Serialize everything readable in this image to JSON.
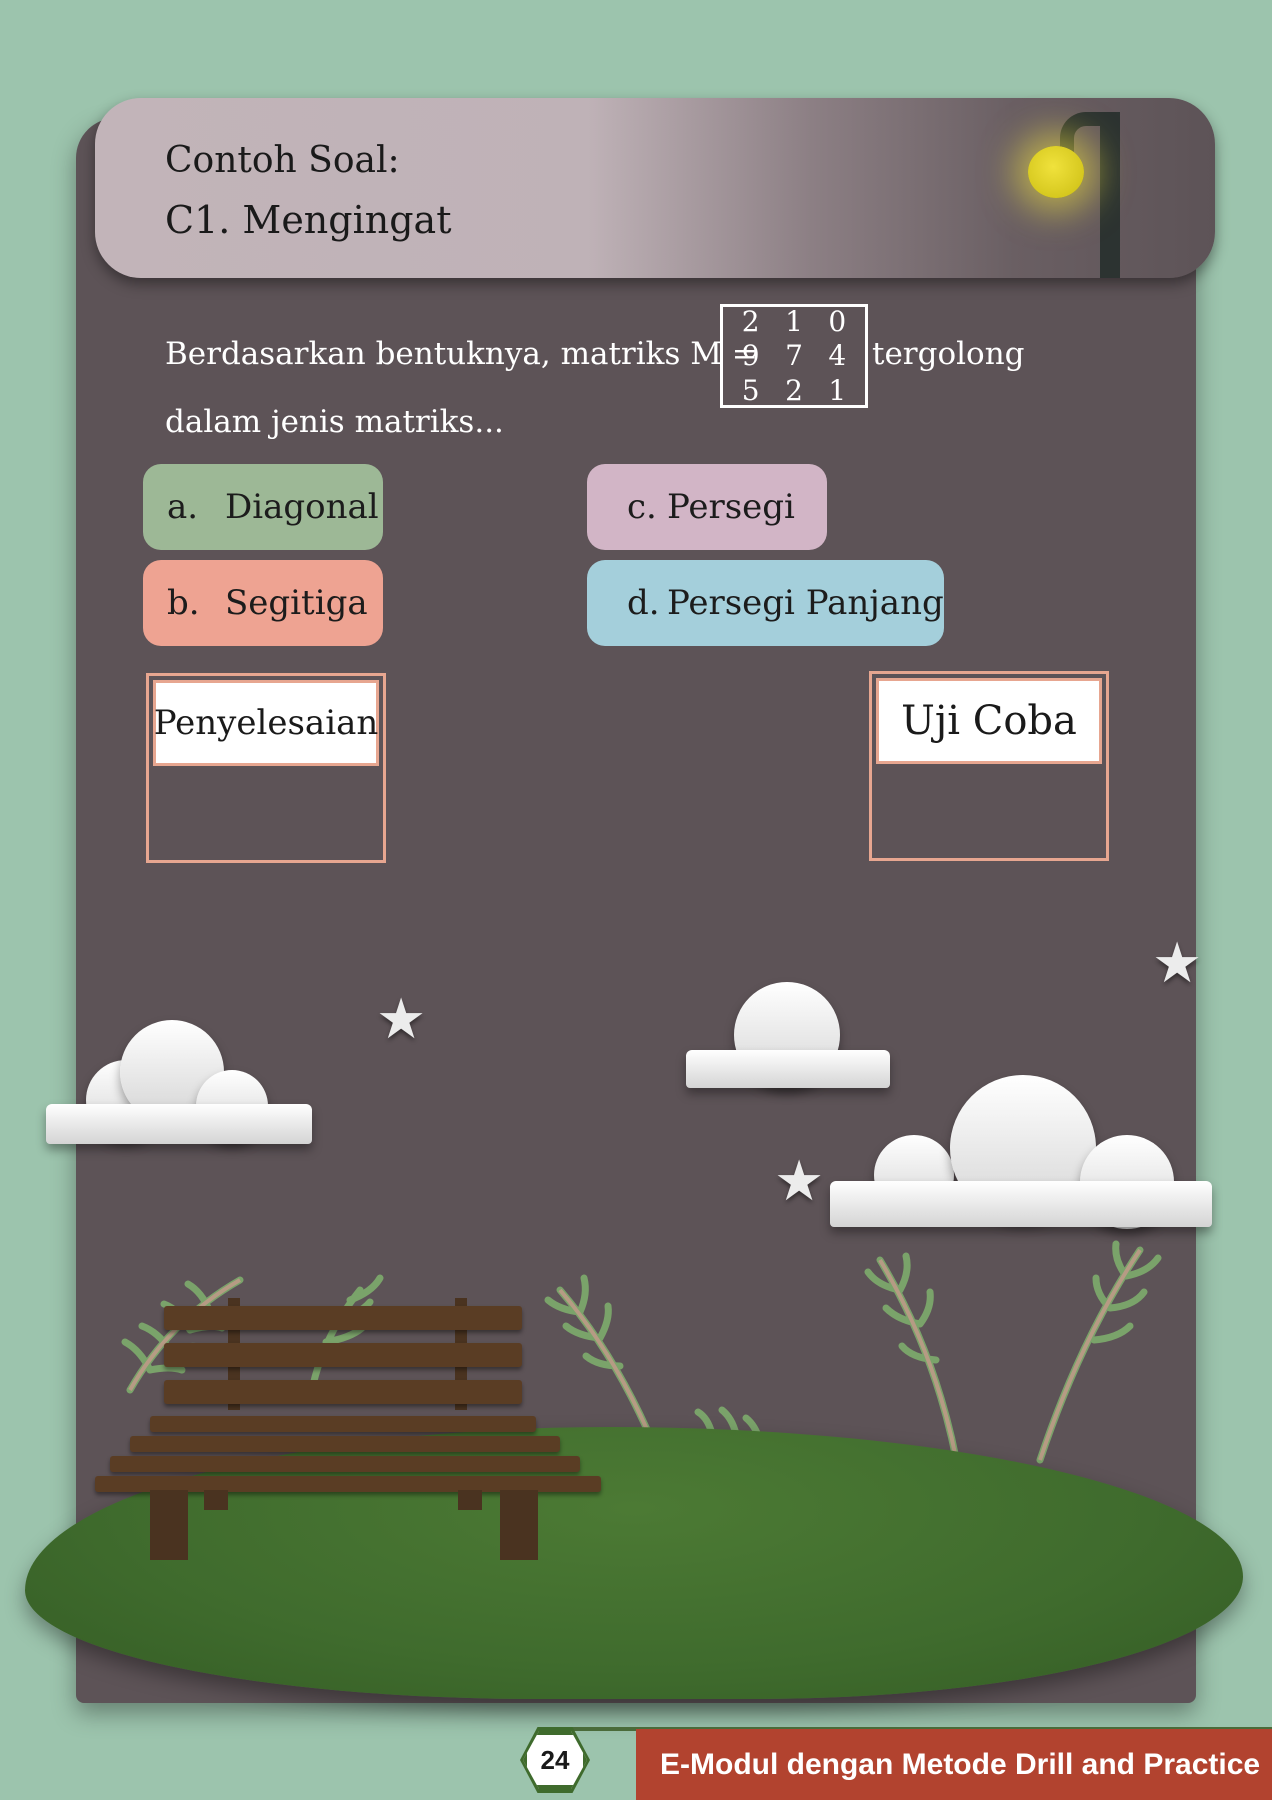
{
  "header": {
    "title": "Contoh Soal:",
    "subtitle": "C1. Mengingat"
  },
  "question": {
    "line1": "Berdasarkan bentuknya, matriks M =",
    "suffix": "tergolong",
    "line2": "dalam jenis matriks..."
  },
  "matrix": {
    "rows": [
      [
        "2",
        "1",
        "0"
      ],
      [
        "9",
        "7",
        "4"
      ],
      [
        "5",
        "2",
        "1"
      ]
    ]
  },
  "options": [
    {
      "key": "a.",
      "label": "Diagonal"
    },
    {
      "key": "b.",
      "label": "Segitiga"
    },
    {
      "key": "c.",
      "label": "Persegi"
    },
    {
      "key": "d.",
      "label": "Persegi Panjang"
    }
  ],
  "buttons": {
    "solution": "Penyelesaian",
    "trial": "Uji Coba"
  },
  "footer": {
    "page_number": "24",
    "text": "E-Modul dengan Metode Drill and Practice"
  },
  "icons": [
    "street-lamp-icon",
    "star-icon",
    "cloud-icon",
    "fern-icon",
    "bench-icon"
  ],
  "colors": {
    "background": "#9cc4ad",
    "panel": "#5d5357",
    "option_a": "#9db896",
    "option_b": "#eea392",
    "option_c": "#d2b5c6",
    "option_d": "#a4cfdb",
    "box_border": "#e7a690",
    "footer": "#b2432f"
  }
}
